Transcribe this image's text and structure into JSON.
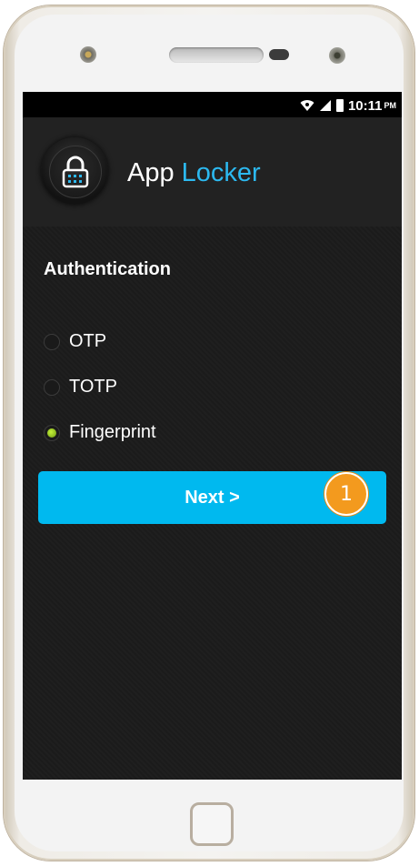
{
  "status_bar": {
    "time": "10:11",
    "ampm": "PM",
    "icons": [
      "wifi-icon",
      "signal-icon",
      "battery-icon"
    ]
  },
  "app": {
    "title_part1": "App",
    "title_part2": "Locker",
    "logo_icon": "padlock-icon"
  },
  "auth": {
    "section_title": "Authentication",
    "options": [
      {
        "label": "OTP",
        "selected": false
      },
      {
        "label": "TOTP",
        "selected": false
      },
      {
        "label": "Fingerprint",
        "selected": true
      }
    ]
  },
  "next_button": {
    "label": "Next >"
  },
  "callout": {
    "label": "1"
  },
  "colors": {
    "accent": "#2cb9f0",
    "button": "#00b9ef",
    "callout": "#f39a1e",
    "radio_selected": "#9acb21"
  }
}
